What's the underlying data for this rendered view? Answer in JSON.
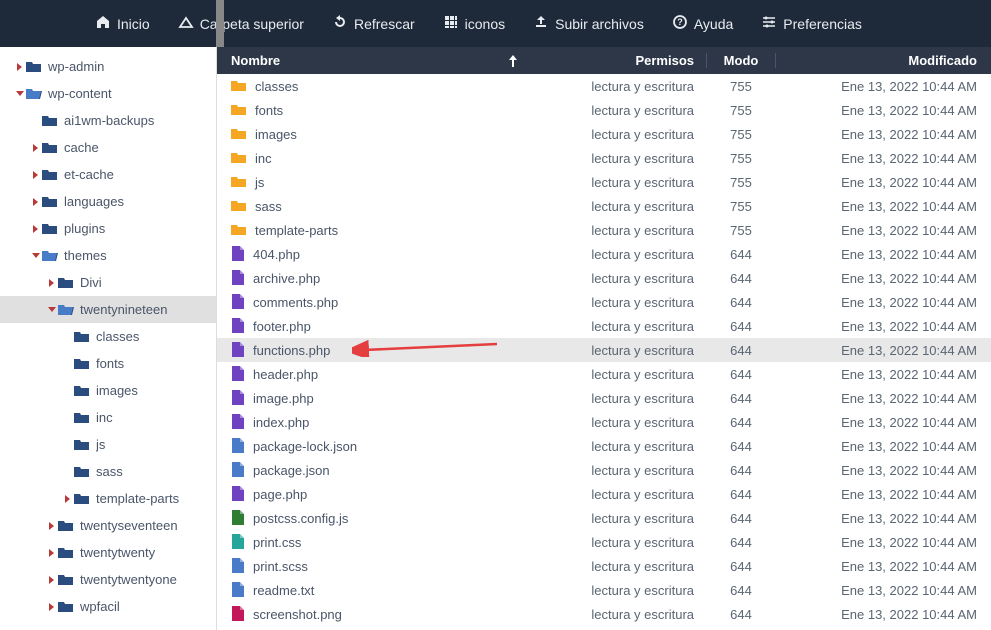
{
  "toolbar": {
    "items": [
      {
        "icon": "home",
        "label": "Inicio"
      },
      {
        "icon": "up",
        "label": "Carpeta superior"
      },
      {
        "icon": "refresh",
        "label": "Refrescar"
      },
      {
        "icon": "grid",
        "label": "iconos"
      },
      {
        "icon": "upload",
        "label": "Subir archivos"
      },
      {
        "icon": "help",
        "label": "Ayuda"
      },
      {
        "icon": "prefs",
        "label": "Preferencias"
      }
    ]
  },
  "tree": [
    {
      "depth": 0,
      "caret": "right",
      "icon": "folder",
      "label": "wp-admin"
    },
    {
      "depth": 0,
      "caret": "down",
      "icon": "folder-open",
      "label": "wp-content"
    },
    {
      "depth": 1,
      "caret": "none",
      "icon": "folder",
      "label": "ai1wm-backups"
    },
    {
      "depth": 1,
      "caret": "right",
      "icon": "folder",
      "label": "cache"
    },
    {
      "depth": 1,
      "caret": "right",
      "icon": "folder",
      "label": "et-cache"
    },
    {
      "depth": 1,
      "caret": "right",
      "icon": "folder",
      "label": "languages"
    },
    {
      "depth": 1,
      "caret": "right",
      "icon": "folder",
      "label": "plugins"
    },
    {
      "depth": 1,
      "caret": "down",
      "icon": "folder-open",
      "label": "themes"
    },
    {
      "depth": 2,
      "caret": "right",
      "icon": "folder",
      "label": "Divi"
    },
    {
      "depth": 2,
      "caret": "down",
      "icon": "folder-open",
      "label": "twentynineteen",
      "selected": true
    },
    {
      "depth": 3,
      "caret": "none",
      "icon": "folder",
      "label": "classes"
    },
    {
      "depth": 3,
      "caret": "none",
      "icon": "folder",
      "label": "fonts"
    },
    {
      "depth": 3,
      "caret": "none",
      "icon": "folder",
      "label": "images"
    },
    {
      "depth": 3,
      "caret": "none",
      "icon": "folder",
      "label": "inc"
    },
    {
      "depth": 3,
      "caret": "none",
      "icon": "folder",
      "label": "js"
    },
    {
      "depth": 3,
      "caret": "none",
      "icon": "folder",
      "label": "sass"
    },
    {
      "depth": 3,
      "caret": "right",
      "icon": "folder",
      "label": "template-parts"
    },
    {
      "depth": 2,
      "caret": "right",
      "icon": "folder",
      "label": "twentyseventeen"
    },
    {
      "depth": 2,
      "caret": "right",
      "icon": "folder",
      "label": "twentytwenty"
    },
    {
      "depth": 2,
      "caret": "right",
      "icon": "folder",
      "label": "twentytwentyone"
    },
    {
      "depth": 2,
      "caret": "right",
      "icon": "folder",
      "label": "wpfacil"
    }
  ],
  "columns": {
    "name": "Nombre",
    "perm": "Permisos",
    "mode": "Modo",
    "mod": "Modificado"
  },
  "files": [
    {
      "icon": "folder",
      "name": "classes",
      "perm": "lectura y escritura",
      "mode": "755",
      "mod": "Ene 13, 2022 10:44 AM"
    },
    {
      "icon": "folder",
      "name": "fonts",
      "perm": "lectura y escritura",
      "mode": "755",
      "mod": "Ene 13, 2022 10:44 AM"
    },
    {
      "icon": "folder",
      "name": "images",
      "perm": "lectura y escritura",
      "mode": "755",
      "mod": "Ene 13, 2022 10:44 AM"
    },
    {
      "icon": "folder",
      "name": "inc",
      "perm": "lectura y escritura",
      "mode": "755",
      "mod": "Ene 13, 2022 10:44 AM"
    },
    {
      "icon": "folder",
      "name": "js",
      "perm": "lectura y escritura",
      "mode": "755",
      "mod": "Ene 13, 2022 10:44 AM"
    },
    {
      "icon": "folder",
      "name": "sass",
      "perm": "lectura y escritura",
      "mode": "755",
      "mod": "Ene 13, 2022 10:44 AM"
    },
    {
      "icon": "folder",
      "name": "template-parts",
      "perm": "lectura y escritura",
      "mode": "755",
      "mod": "Ene 13, 2022 10:44 AM"
    },
    {
      "icon": "php",
      "name": "404.php",
      "perm": "lectura y escritura",
      "mode": "644",
      "mod": "Ene 13, 2022 10:44 AM"
    },
    {
      "icon": "php",
      "name": "archive.php",
      "perm": "lectura y escritura",
      "mode": "644",
      "mod": "Ene 13, 2022 10:44 AM"
    },
    {
      "icon": "php",
      "name": "comments.php",
      "perm": "lectura y escritura",
      "mode": "644",
      "mod": "Ene 13, 2022 10:44 AM"
    },
    {
      "icon": "php",
      "name": "footer.php",
      "perm": "lectura y escritura",
      "mode": "644",
      "mod": "Ene 13, 2022 10:44 AM"
    },
    {
      "icon": "php",
      "name": "functions.php",
      "perm": "lectura y escritura",
      "mode": "644",
      "mod": "Ene 13, 2022 10:44 AM",
      "highlighted": true
    },
    {
      "icon": "php",
      "name": "header.php",
      "perm": "lectura y escritura",
      "mode": "644",
      "mod": "Ene 13, 2022 10:44 AM"
    },
    {
      "icon": "php",
      "name": "image.php",
      "perm": "lectura y escritura",
      "mode": "644",
      "mod": "Ene 13, 2022 10:44 AM"
    },
    {
      "icon": "php",
      "name": "index.php",
      "perm": "lectura y escritura",
      "mode": "644",
      "mod": "Ene 13, 2022 10:44 AM"
    },
    {
      "icon": "json",
      "name": "package-lock.json",
      "perm": "lectura y escritura",
      "mode": "644",
      "mod": "Ene 13, 2022 10:44 AM"
    },
    {
      "icon": "json",
      "name": "package.json",
      "perm": "lectura y escritura",
      "mode": "644",
      "mod": "Ene 13, 2022 10:44 AM"
    },
    {
      "icon": "php",
      "name": "page.php",
      "perm": "lectura y escritura",
      "mode": "644",
      "mod": "Ene 13, 2022 10:44 AM"
    },
    {
      "icon": "js",
      "name": "postcss.config.js",
      "perm": "lectura y escritura",
      "mode": "644",
      "mod": "Ene 13, 2022 10:44 AM"
    },
    {
      "icon": "css",
      "name": "print.css",
      "perm": "lectura y escritura",
      "mode": "644",
      "mod": "Ene 13, 2022 10:44 AM"
    },
    {
      "icon": "scss",
      "name": "print.scss",
      "perm": "lectura y escritura",
      "mode": "644",
      "mod": "Ene 13, 2022 10:44 AM"
    },
    {
      "icon": "txt",
      "name": "readme.txt",
      "perm": "lectura y escritura",
      "mode": "644",
      "mod": "Ene 13, 2022 10:44 AM"
    },
    {
      "icon": "img",
      "name": "screenshot.png",
      "perm": "lectura y escritura",
      "mode": "644",
      "mod": "Ene 13, 2022 10:44 AM"
    }
  ]
}
